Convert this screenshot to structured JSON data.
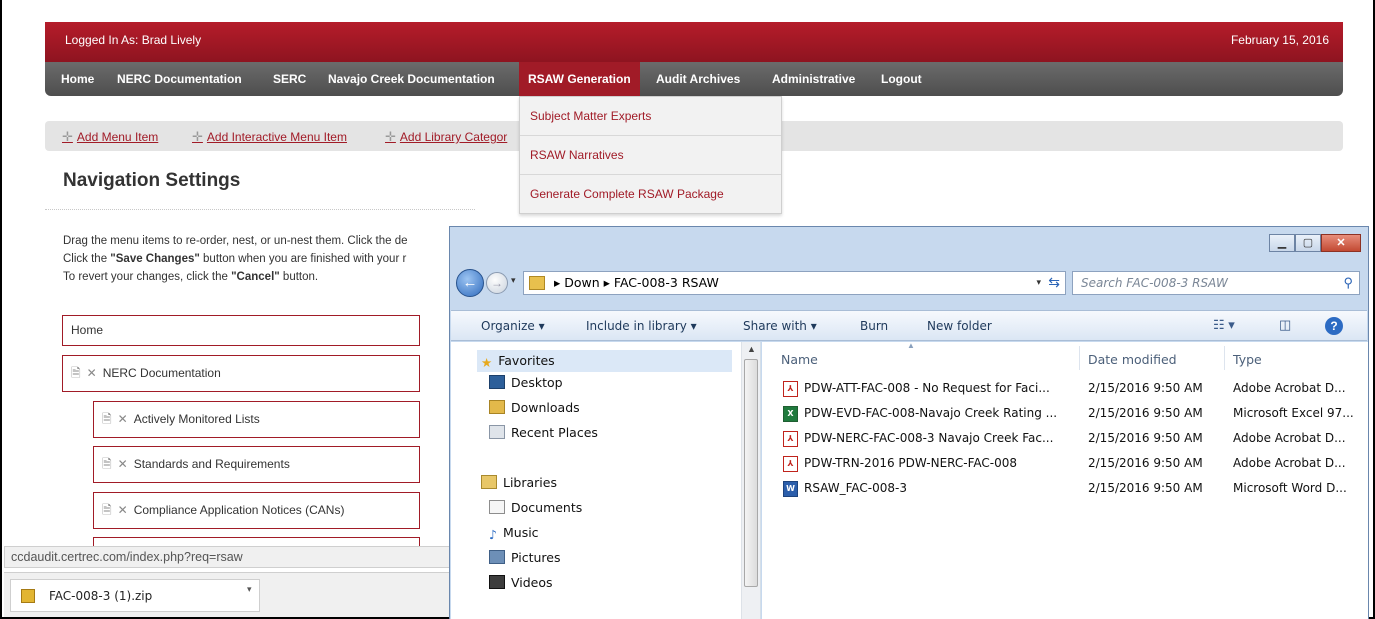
{
  "site": {
    "logged_in": "Logged In As: Brad Lively",
    "date": "February 15, 2016",
    "nav": [
      "Home",
      "NERC Documentation",
      "SERC",
      "Navajo Creek Documentation",
      "RSAW Generation",
      "Audit Archives",
      "Administrative",
      "Logout"
    ],
    "dropdown": [
      "Subject Matter Experts",
      "RSAW Narratives",
      "Generate Complete RSAW Package"
    ],
    "toolbar": [
      "Add Menu Item",
      "Add Interactive Menu Item",
      "Add Library Categor"
    ],
    "page_title": "Navigation Settings",
    "instructions": {
      "line1": "Drag the menu items to re-order, nest, or un-nest them. Click the de",
      "line2_pre": "Click the ",
      "line2_bold": "\"Save Changes\"",
      "line2_post": " button when you are finished with your r",
      "line3_pre": "To revert your changes, click the ",
      "line3_bold": "\"Cancel\"",
      "line3_post": " button."
    },
    "menu_items": [
      "Home",
      "NERC Documentation",
      "Actively Monitored Lists",
      "Standards and Requirements",
      "Compliance Application Notices (CANs)"
    ]
  },
  "browser": {
    "status_url": "ccdaudit.certrec.com/index.php?req=rsaw",
    "download_file": "FAC-008-3 (1).zip"
  },
  "explorer": {
    "breadcrumb": [
      "Down",
      "FAC-008-3 RSAW"
    ],
    "search_placeholder": "Search FAC-008-3 RSAW",
    "commands": [
      "Organize ▾",
      "Include in library ▾",
      "Share with ▾",
      "Burn",
      "New folder"
    ],
    "nav_favorites": "Favorites",
    "nav_favorite_items": [
      "Desktop",
      "Downloads",
      "Recent Places"
    ],
    "nav_libraries": "Libraries",
    "nav_library_items": [
      "Documents",
      "Music",
      "Pictures",
      "Videos"
    ],
    "columns": {
      "name": "Name",
      "date": "Date modified",
      "type": "Type"
    },
    "files": [
      {
        "icon": "pdf",
        "name": "PDW-ATT-FAC-008 - No Request for Faci...",
        "date": "2/15/2016 9:50 AM",
        "type": "Adobe Acrobat D..."
      },
      {
        "icon": "xls",
        "name": "PDW-EVD-FAC-008-Navajo Creek Rating ...",
        "date": "2/15/2016 9:50 AM",
        "type": "Microsoft Excel 97..."
      },
      {
        "icon": "pdf",
        "name": "PDW-NERC-FAC-008-3 Navajo Creek Fac...",
        "date": "2/15/2016 9:50 AM",
        "type": "Adobe Acrobat D..."
      },
      {
        "icon": "pdf",
        "name": "PDW-TRN-2016 PDW-NERC-FAC-008",
        "date": "2/15/2016 9:50 AM",
        "type": "Adobe Acrobat D..."
      },
      {
        "icon": "doc",
        "name": "RSAW_FAC-008-3",
        "date": "2/15/2016 9:50 AM",
        "type": "Microsoft Word D..."
      }
    ]
  },
  "colors": {
    "brand_red": "#a11b27",
    "nav_gray": "#555555",
    "win_chrome": "#c7d9ee"
  }
}
